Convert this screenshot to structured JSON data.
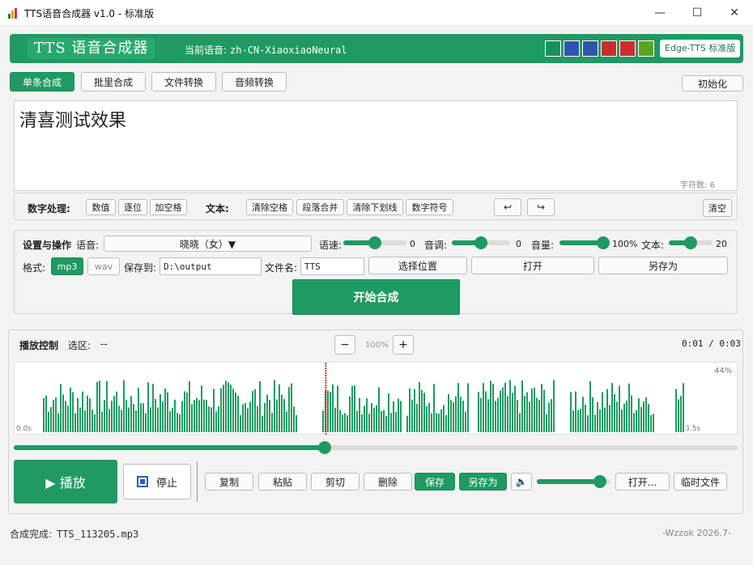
{
  "window": {
    "title": "TTS语音合成器 v1.0 - 标准版",
    "controls": {
      "minimize": "—",
      "maximize": "☐",
      "close": "✕"
    }
  },
  "header": {
    "title": "TTS 语音合成器",
    "voice_label": "当前语音:",
    "voice_value": "zh-CN-XiaoxiaoNeural",
    "swatches": [
      "#1a9160",
      "#2f55b0",
      "#2f55b0",
      "#c9302c",
      "#c9302c",
      "#5aa51d"
    ],
    "edition": "Edge-TTS 标准版"
  },
  "tabs": [
    "单条合成",
    "批里合成",
    "文件转换",
    "音频转换"
  ],
  "init_button": "初始化",
  "editor": {
    "text": "清喜测试效果",
    "char_count": "字符数: 6"
  },
  "toolbar": {
    "num_label": "数字处理:",
    "num_buttons": [
      "数值",
      "逐位",
      "加空格"
    ],
    "text_label": "文本:",
    "text_buttons": [
      "清除空格",
      "段落合并",
      "清除下划线",
      "数字符号"
    ],
    "undo": "↩",
    "redo": "↪",
    "clear": "清空"
  },
  "settings": {
    "title": "设置与操作",
    "voice_label": "语音:",
    "voice_value": "晓晓（女）▼",
    "rate_label": "语速:",
    "rate_value": "0",
    "rate_level": 0.5,
    "pitch_label": "音调:",
    "pitch_value": "0",
    "pitch_level": 0.5,
    "volume_label": "音量:",
    "volume_value": "100%",
    "volume_level": 1.0,
    "text_label": "文本:",
    "text_value": "20",
    "text_level": 0.5,
    "format_label": "格式:",
    "format_mp3": "mp3",
    "format_wav": "wav",
    "save_to_label": "保存到:",
    "save_to_value": "D:\\output",
    "filename_label": "文件名:",
    "filename_value": "TTS",
    "choose_location": "选择位置",
    "open": "打开",
    "save_as": "另存为",
    "start": "开始合成"
  },
  "playback": {
    "title": "播放控制",
    "selection_label": "选区:",
    "selection_value": "--",
    "zoom_out": "−",
    "zoom_value": "100%",
    "zoom_in": "+",
    "time": "0:01 / 0:03",
    "wave_percent": "44%",
    "wave_start": "0.0s",
    "wave_end": "3.5s",
    "playhead_fraction": 0.43,
    "seek_fraction": 0.43,
    "play": "▶  播放",
    "stop": "停止",
    "actions": [
      "复制",
      "粘贴",
      "剪切",
      "删除"
    ],
    "save": "保存",
    "save_as": "另存为",
    "speaker_icon": "🔈",
    "volume_level": 0.87,
    "open": "打开...",
    "temp_file": "临时文件"
  },
  "status": {
    "label": "合成完成:",
    "file": "TTS_113205.mp3",
    "credit": "-Wzzok 2026.7-"
  }
}
